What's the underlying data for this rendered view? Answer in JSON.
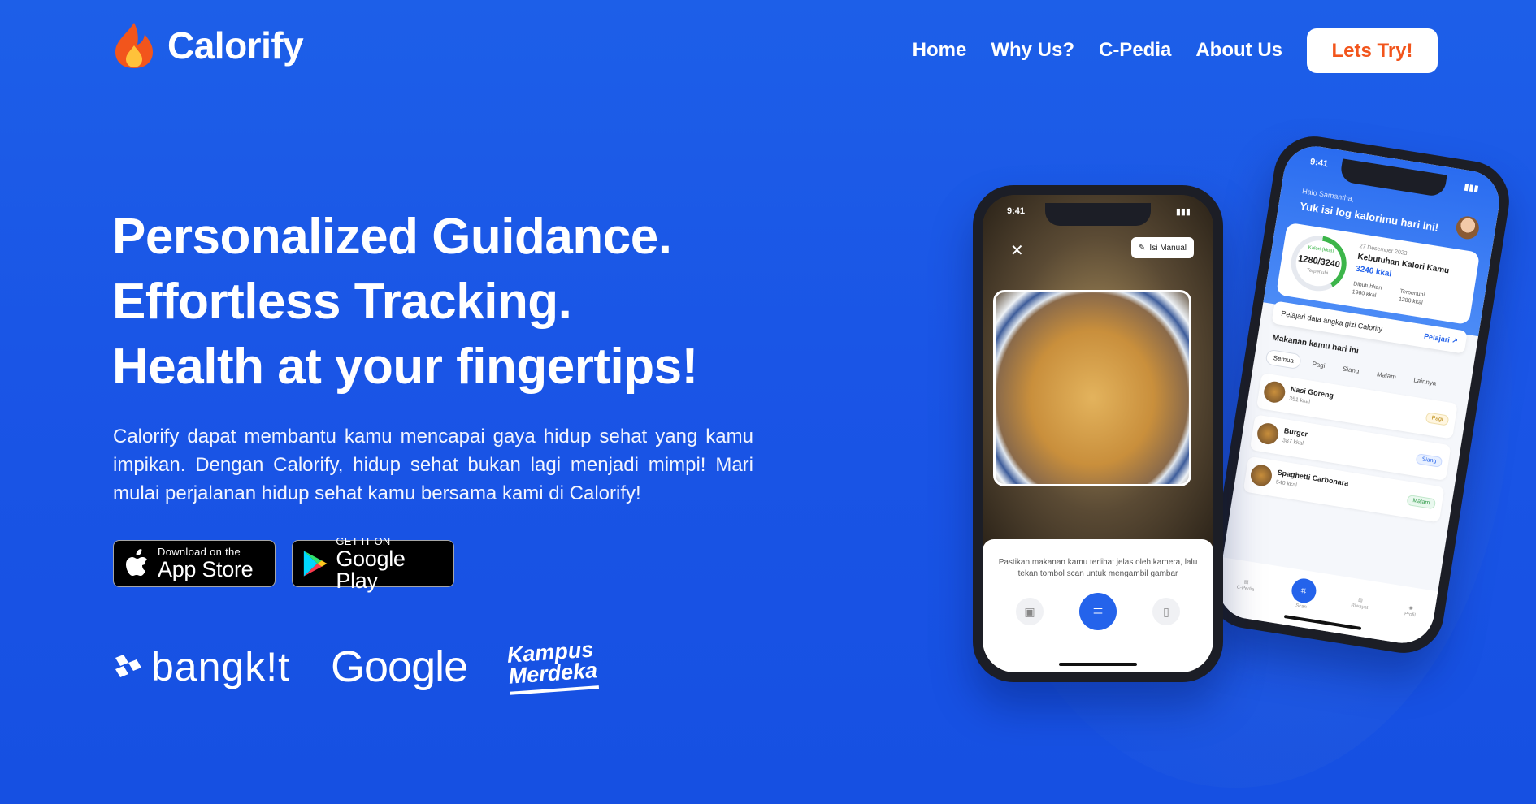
{
  "brand": {
    "name": "Calorify",
    "accent": "#f2551c",
    "primary": "#1d5fe8"
  },
  "nav": {
    "links": [
      "Home",
      "Why Us?",
      "C-Pedia",
      "About Us"
    ],
    "cta": "Lets Try!"
  },
  "hero": {
    "headline": [
      "Personalized Guidance.",
      "Effortless Tracking.",
      "Health at your fingertips!"
    ],
    "description": "Calorify dapat membantu kamu mencapai gaya hidup sehat yang kamu impikan. Dengan Calorify, hidup sehat bukan lagi menjadi mimpi! Mari mulai perjalanan hidup sehat kamu bersama kami di Calorify!",
    "appstore": {
      "small": "Download on the",
      "big": "App Store"
    },
    "googleplay": {
      "small": "GET IT ON",
      "big": "Google Play"
    }
  },
  "partners": {
    "bangkit": "bangk!t",
    "google": "Google",
    "kampus_line1": "Kampus",
    "kampus_line2": "Merdeka"
  },
  "phone_scan": {
    "time": "9:41",
    "isi_manual": "Isi Manual",
    "hint": "Pastikan makanan kamu terlihat jelas oleh kamera, lalu tekan tombol scan untuk mengambil gambar"
  },
  "phone_home": {
    "time": "9:41",
    "greet_small": "Halo Samantha,",
    "greet_big": "Yuk isi log kalorimu hari ini!",
    "ring_label": "Kalori (kkal)",
    "ring_value": "1280/3240",
    "ring_sub": "Terpenuhi",
    "date": "27 Desember 2023",
    "need_title": "Kebutuhan Kalori Kamu",
    "need_kcal": "3240 kkal",
    "need_label": "Dibutuhkan",
    "need_value": "1960 kkal",
    "done_label": "Terpenuhi",
    "done_value": "1280 kkal",
    "learn_text": "Pelajari data angka gizi Calorify",
    "learn_link": "Pelajari",
    "meals_heading": "Makanan kamu hari ini",
    "tabs": [
      "Semua",
      "Pagi",
      "Siang",
      "Malam",
      "Lainnya"
    ],
    "meals": [
      {
        "name": "Nasi Goreng",
        "kcal": "351 kkal",
        "time": "Pagi"
      },
      {
        "name": "Burger",
        "kcal": "387 kkal",
        "time": "Siang"
      },
      {
        "name": "Spaghetti Carbonara",
        "kcal": "540 kkal",
        "time": "Malam"
      }
    ],
    "bottom_nav": [
      "C-Pedia",
      "Scan",
      "Riwayat",
      "Profil"
    ]
  }
}
